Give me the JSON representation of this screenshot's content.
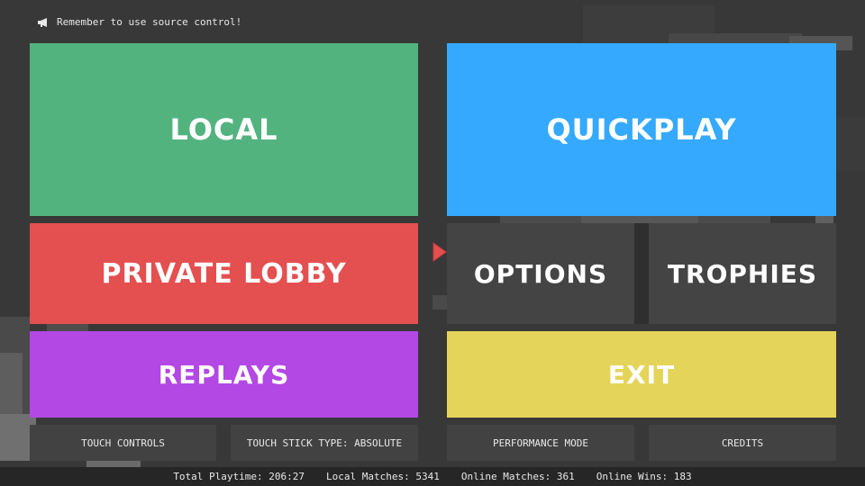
{
  "tip": {
    "icon": "megaphone-icon",
    "text": "Remember to use source control!"
  },
  "menu": {
    "local": "LOCAL",
    "quickplay": "QUICKPLAY",
    "private_lobby": "PRIVATE LOBBY",
    "options": "OPTIONS",
    "trophies": "TROPHIES",
    "replays": "REPLAYS",
    "exit": "EXIT"
  },
  "bottom_buttons": {
    "touch_controls": "TOUCH CONTROLS",
    "touch_stick": "TOUCH STICK TYPE: ABSOLUTE",
    "performance_mode": "PERFORMANCE MODE",
    "credits": "CREDITS"
  },
  "stats": {
    "playtime": "Total Playtime: 206:27",
    "local_matches": "Local Matches: 5341",
    "online_matches": "Online Matches: 361",
    "online_wins": "Online Wins: 183"
  },
  "cursor": {
    "icon": "triangle-pointer-icon",
    "color": "#e44f50"
  },
  "colors": {
    "background": "#383838",
    "local": "#52b37f",
    "quickplay": "#34a9fe",
    "private_lobby": "#e44f50",
    "options": "#444444",
    "trophies": "#444444",
    "replays": "#b348e4",
    "exit": "#e4d55a",
    "bottom_button": "#424242",
    "stats_bar": "#262626"
  }
}
